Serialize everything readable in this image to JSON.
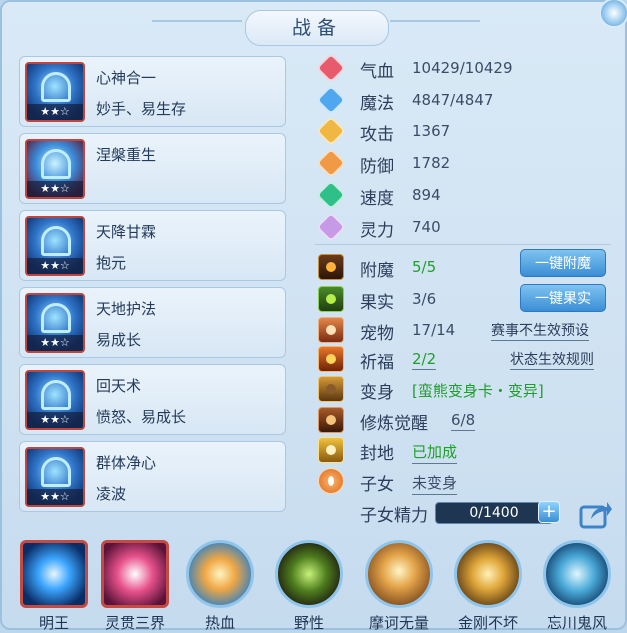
{
  "title": "战备",
  "skill_cards": [
    {
      "name": "心神合一",
      "sub": "妙手、易生存",
      "stars": "★★☆"
    },
    {
      "name": "涅槃重生",
      "sub": "",
      "stars": "★★☆"
    },
    {
      "name": "天降甘霖",
      "sub": "抱元",
      "stars": "★★☆"
    },
    {
      "name": "天地护法",
      "sub": "易成长",
      "stars": "★★☆"
    },
    {
      "name": "回天术",
      "sub": "愤怒、易成长",
      "stars": "★★☆"
    },
    {
      "name": "群体净心",
      "sub": "凌波",
      "stars": "★★☆"
    }
  ],
  "stats": [
    {
      "label": "气血",
      "value": "10429/10429",
      "icon": "heart-icon",
      "color": "#e75c6d"
    },
    {
      "label": "魔法",
      "value": "4847/4847",
      "icon": "mana-icon",
      "color": "#4fa7f0"
    },
    {
      "label": "攻击",
      "value": "1367",
      "icon": "attack-icon",
      "color": "#f0b742"
    },
    {
      "label": "防御",
      "value": "1782",
      "icon": "defense-icon",
      "color": "#f09a45"
    },
    {
      "label": "速度",
      "value": "894",
      "icon": "speed-icon",
      "color": "#2fc08a"
    },
    {
      "label": "灵力",
      "value": "740",
      "icon": "spirit-icon",
      "color": "#c69ae6"
    }
  ],
  "equip": {
    "enchant": {
      "label": "附魔",
      "value": "5/5",
      "button": "一键附魔"
    },
    "fruit": {
      "label": "果实",
      "value": "3/6",
      "button": "一键果实"
    },
    "pet": {
      "label": "宠物",
      "value": "17/14",
      "link": "赛事不生效预设"
    },
    "blessing": {
      "label": "祈福",
      "value": "2/2",
      "link": "状态生效规则"
    },
    "transform": {
      "label": "变身",
      "value": "[蛮熊变身卡・变异]"
    },
    "cultivation": {
      "label": "修炼觉醒",
      "value": "6/8"
    },
    "seal": {
      "label": "封地",
      "value": "已加成"
    },
    "child": {
      "label": "子女",
      "value": "未变身"
    },
    "child_energy": {
      "label": "子女精力",
      "value": "0/1400",
      "plus": "+"
    }
  },
  "bottom_skills": [
    {
      "name": "明王",
      "style": "square",
      "colors": [
        "#e8f6ff",
        "#3ca6ff",
        "#0a2d66"
      ]
    },
    {
      "name": "灵贯三界",
      "style": "square",
      "colors": [
        "#fff",
        "#e8528c",
        "#5a1238"
      ]
    },
    {
      "name": "热血",
      "style": "circle",
      "colors": [
        "#fff4c2",
        "#f0a745",
        "#2f7fc5"
      ]
    },
    {
      "name": "野性",
      "style": "circle",
      "colors": [
        "#c8f27a",
        "#4d7d1d",
        "#1e1a12"
      ]
    },
    {
      "name": "摩诃无量",
      "style": "circle",
      "colors": [
        "#fff2b8",
        "#e1a543",
        "#6c3c16"
      ]
    },
    {
      "name": "金刚不坏",
      "style": "circle",
      "colors": [
        "#fff2b8",
        "#e0a73a",
        "#5a3a14"
      ]
    },
    {
      "name": "忘川鬼风",
      "style": "circle",
      "colors": [
        "#dff6ff",
        "#49a9d8",
        "#123e6a"
      ]
    }
  ]
}
